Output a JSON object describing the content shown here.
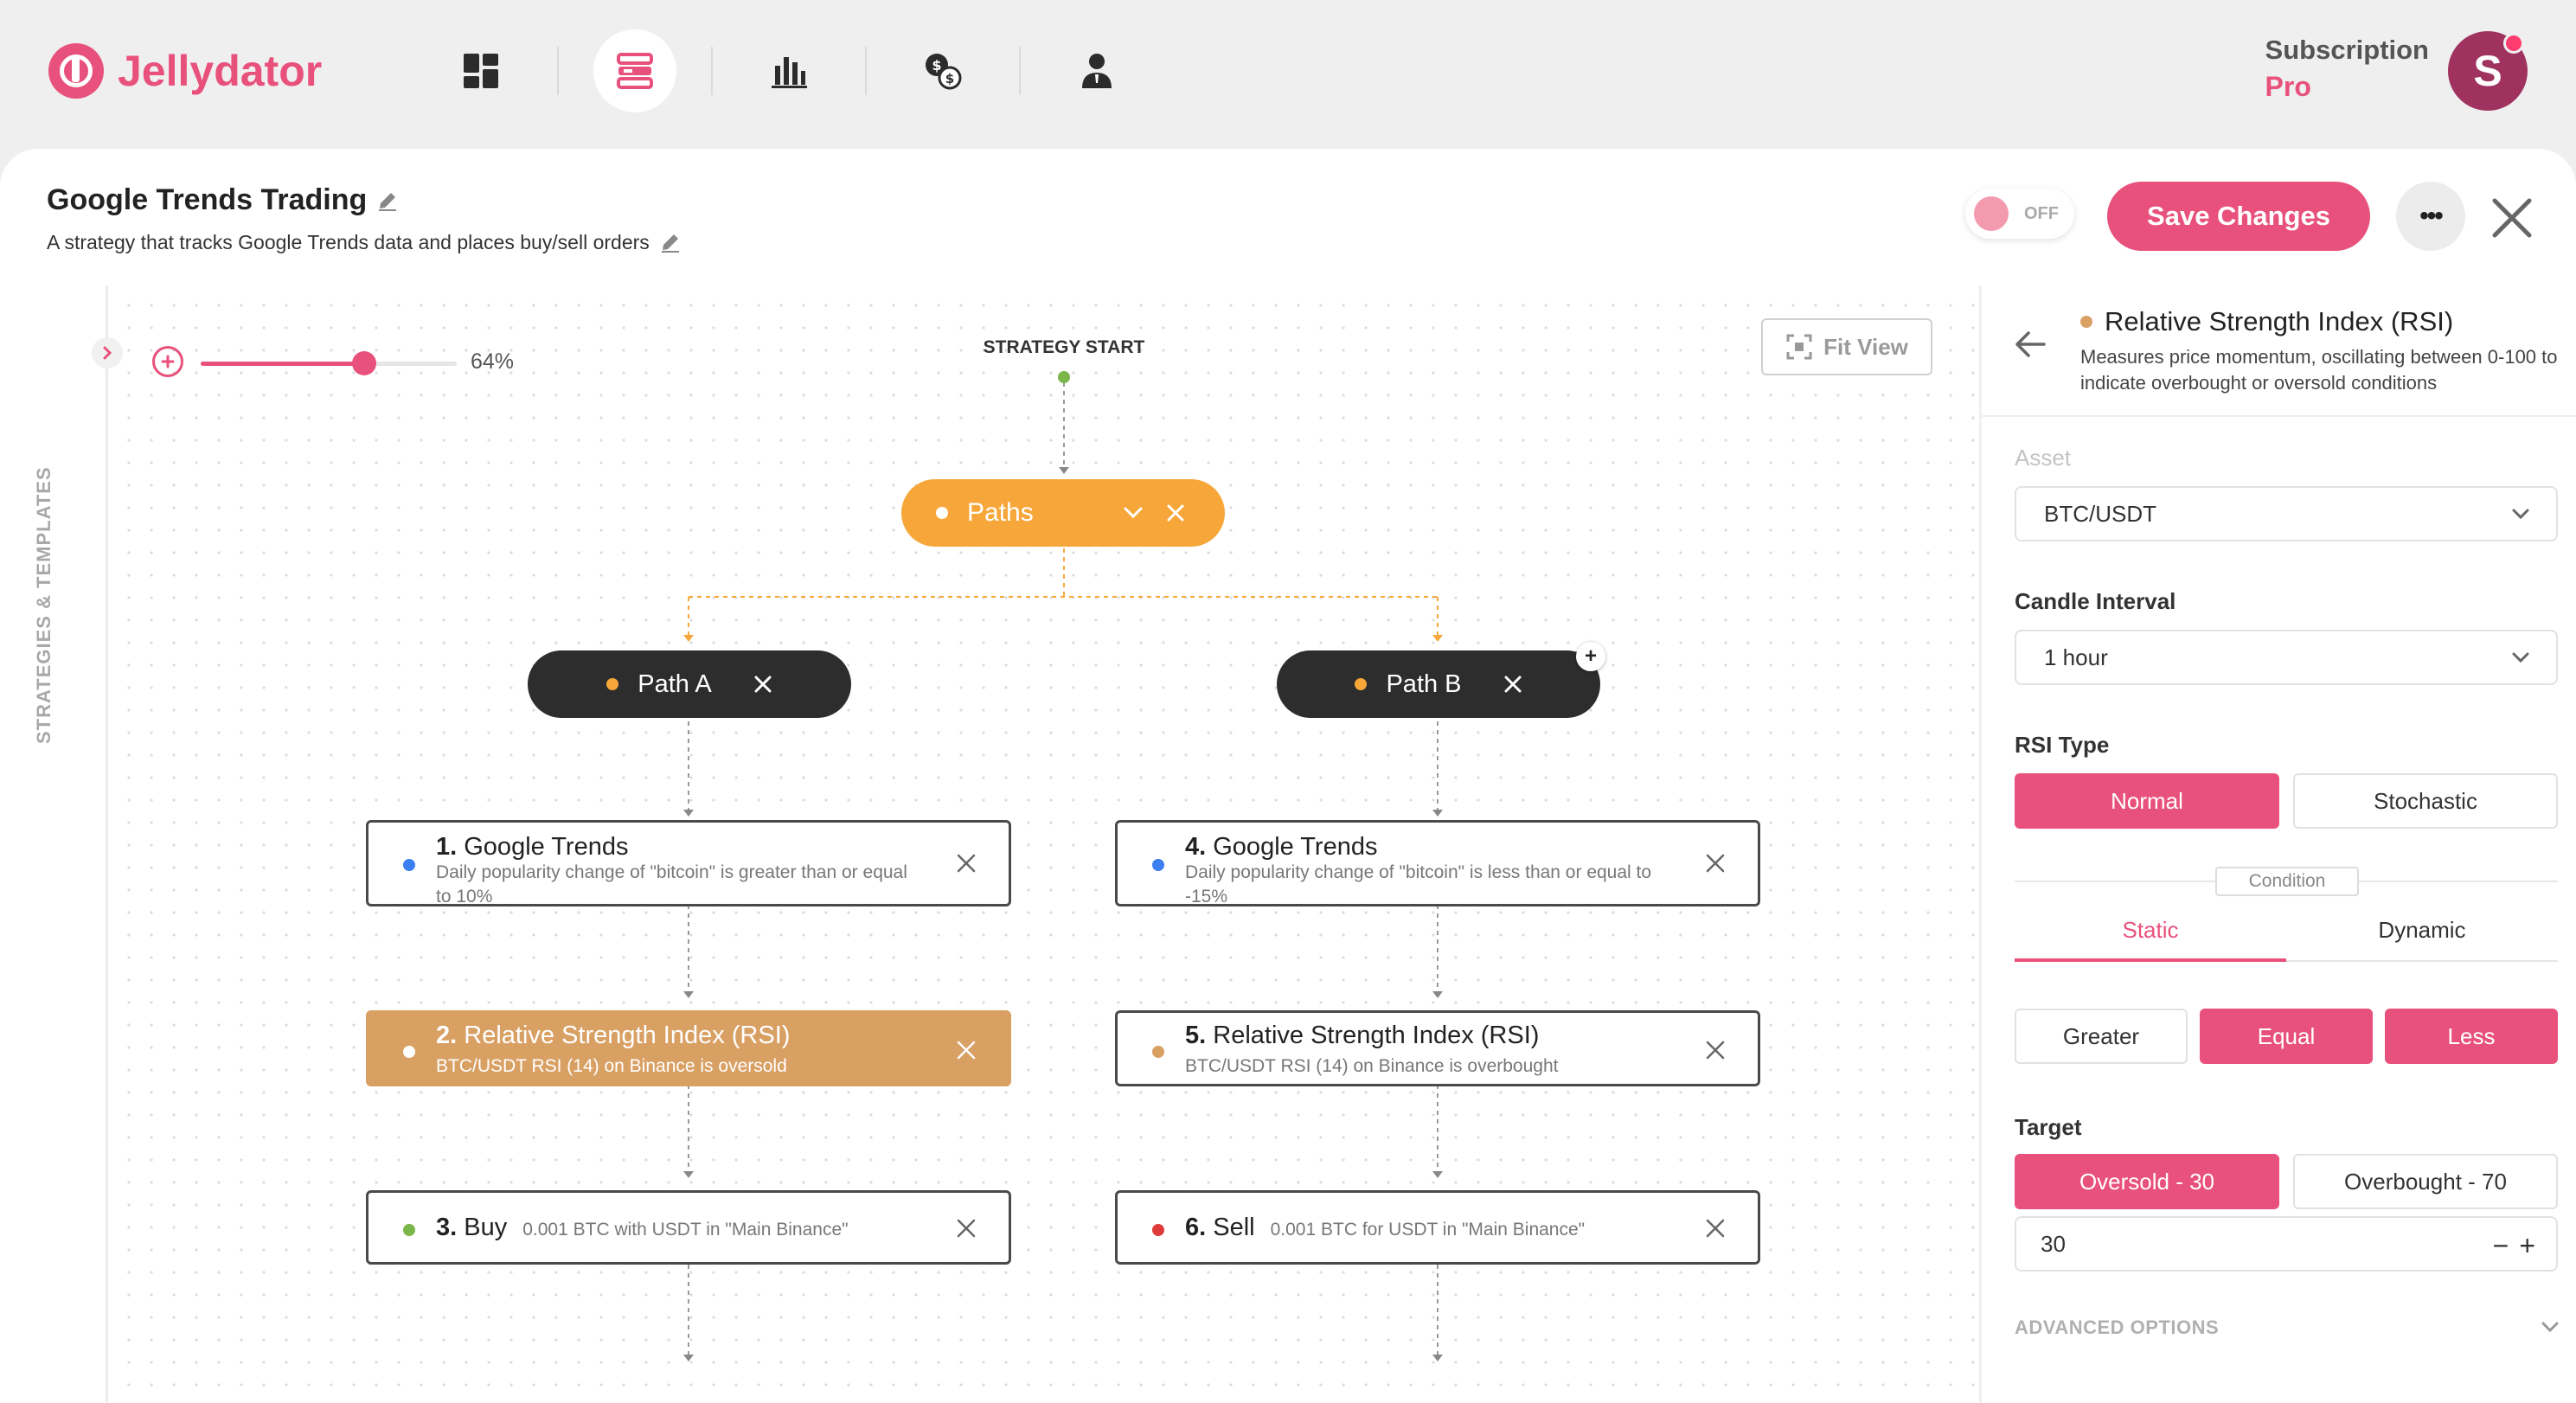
{
  "app": {
    "name": "Jellydator"
  },
  "nav": [
    {
      "icon": "dashboard-icon"
    },
    {
      "icon": "strategies-icon"
    },
    {
      "icon": "bar-chart-icon"
    },
    {
      "icon": "currency-exchange-icon"
    },
    {
      "icon": "user-icon"
    }
  ],
  "subscription": {
    "label": "Subscription",
    "plan": "Pro"
  },
  "user": {
    "avatar_letter": "S"
  },
  "strategy": {
    "title": "Google Trends Trading",
    "description": "A strategy that tracks Google Trends data and places buy/sell orders"
  },
  "toggle": {
    "label": "OFF",
    "on": false
  },
  "actions": {
    "save": "Save Changes",
    "more": "•••"
  },
  "sidebar": {
    "label": "STRATEGIES & TEMPLATES"
  },
  "zoom": {
    "value": 64,
    "label": "64%"
  },
  "fit_view": {
    "label": "Fit View"
  },
  "flow": {
    "start_label": "STRATEGY START",
    "paths_node": {
      "label": "Paths"
    },
    "path_a": {
      "label": "Path A"
    },
    "path_b": {
      "label": "Path B"
    },
    "plus": "+",
    "cards": [
      {
        "num": "1.",
        "title": "Google Trends",
        "subtitle": "Daily popularity change of \"bitcoin\" is greater than or equal to 10%",
        "dot": "#3b7ff0"
      },
      {
        "num": "2.",
        "title": "Relative Strength Index (RSI)",
        "subtitle": "BTC/USDT RSI (14) on Binance is oversold",
        "dot": "#ffffff"
      },
      {
        "num": "3.",
        "title": "Buy",
        "subtitle": "0.001 BTC with USDT in \"Main Binance\"",
        "dot": "#7ab648"
      },
      {
        "num": "4.",
        "title": "Google Trends",
        "subtitle": "Daily popularity change of \"bitcoin\" is less than or equal to -15%",
        "dot": "#3b7ff0"
      },
      {
        "num": "5.",
        "title": "Relative Strength Index (RSI)",
        "subtitle": "BTC/USDT RSI (14) on Binance is overbought",
        "dot": "#d9a064"
      },
      {
        "num": "6.",
        "title": "Sell",
        "subtitle": "0.001 BTC for USDT in \"Main Binance\"",
        "dot": "#e03b3b"
      }
    ]
  },
  "panel": {
    "title": "Relative Strength Index (RSI)",
    "description": "Measures price momentum, oscillating between 0-100 to indicate overbought or oversold conditions",
    "asset": {
      "label": "Asset",
      "value": "BTC/USDT"
    },
    "interval": {
      "label": "Candle Interval",
      "value": "1 hour"
    },
    "rsi_type": {
      "label": "RSI Type",
      "options": [
        "Normal",
        "Stochastic"
      ],
      "selected": "Normal"
    },
    "condition": {
      "label": "Condition",
      "tabs": [
        "Static",
        "Dynamic"
      ],
      "active_tab": "Static",
      "operators": [
        "Greater",
        "Equal",
        "Less"
      ],
      "selected_operators": [
        "Equal",
        "Less"
      ]
    },
    "target": {
      "label": "Target",
      "options": [
        "Oversold - 30",
        "Overbought - 70"
      ],
      "selected": "Oversold - 30",
      "value": "30"
    },
    "stepper": {
      "minus": "−",
      "plus": "+"
    },
    "advanced": {
      "label": "ADVANCED OPTIONS"
    }
  },
  "colors": {
    "accent": "#e8517c",
    "paths": "#f7a73a",
    "selected_card": "#d9a064",
    "dark_node": "#2d2d2d"
  }
}
